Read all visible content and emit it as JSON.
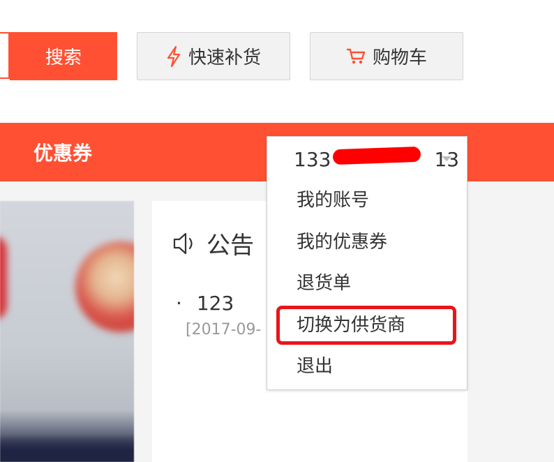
{
  "header": {
    "search_label": "搜索",
    "quick_restock_label": "快速补货",
    "cart_label": "购物车"
  },
  "nav": {
    "coupon_label": "优惠券"
  },
  "account_menu": {
    "account_prefix": "133",
    "account_suffix": "13",
    "items": [
      {
        "label": "我的账号"
      },
      {
        "label": "我的优惠券"
      },
      {
        "label": "退货单"
      },
      {
        "label": "切换为供货商"
      },
      {
        "label": "退出"
      }
    ]
  },
  "notice": {
    "title": "公告",
    "items": [
      {
        "bullet": "·",
        "text": "123",
        "date": "[2017-09-"
      }
    ]
  },
  "colors": {
    "brand": "#ff5033",
    "highlight": "#e8151b",
    "redaction": "#ff0000"
  }
}
